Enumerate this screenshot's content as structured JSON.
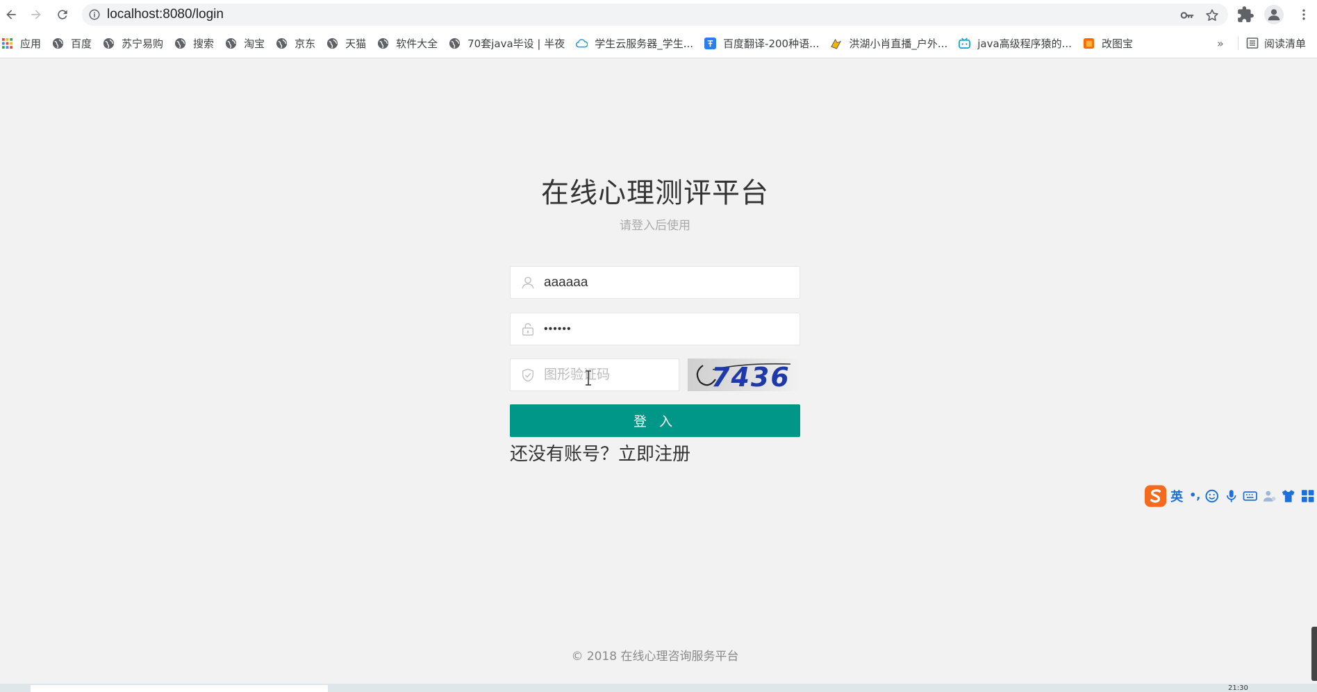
{
  "browser": {
    "url": "localhost:8080/login",
    "bookmarks": [
      {
        "label": "应用",
        "icon": "apps-grid-icon"
      },
      {
        "label": "百度",
        "icon": "globe-icon"
      },
      {
        "label": "苏宁易购",
        "icon": "globe-icon"
      },
      {
        "label": "搜索",
        "icon": "globe-icon"
      },
      {
        "label": "淘宝",
        "icon": "globe-icon"
      },
      {
        "label": "京东",
        "icon": "globe-icon"
      },
      {
        "label": "天猫",
        "icon": "globe-icon"
      },
      {
        "label": "软件大全",
        "icon": "globe-icon"
      },
      {
        "label": "70套java毕设 | 半夜",
        "icon": "globe-icon"
      },
      {
        "label": "学生云服务器_学生...",
        "icon": "cloud-icon"
      },
      {
        "label": "百度翻译-200种语...",
        "icon": "translate-icon"
      },
      {
        "label": "洪湖小肖直播_户外...",
        "icon": "game-icon"
      },
      {
        "label": "java高级程序猿的...",
        "icon": "bilibili-icon"
      },
      {
        "label": "改图宝",
        "icon": "image-tool-icon"
      }
    ],
    "overflow_label": "»",
    "reading_list_label": "阅读清单"
  },
  "login": {
    "title": "在线心理测评平台",
    "subtitle": "请登入后使用",
    "username_value": "aaaaaa",
    "password_value": "••••••",
    "captcha_placeholder": "图形验证码",
    "captcha_text": "7436",
    "login_button": "登 入",
    "register_link": "还没有账号？立即注册"
  },
  "footer": {
    "copyright": "© 2018   在线心理咨询服务平台"
  },
  "ime": {
    "language": "英",
    "punct": "•,"
  },
  "taskbar": {
    "clock": "21:30"
  },
  "colors": {
    "primary": "#009688",
    "page_background": "#f2f2f2",
    "captcha_text": "#1f3aa8"
  }
}
